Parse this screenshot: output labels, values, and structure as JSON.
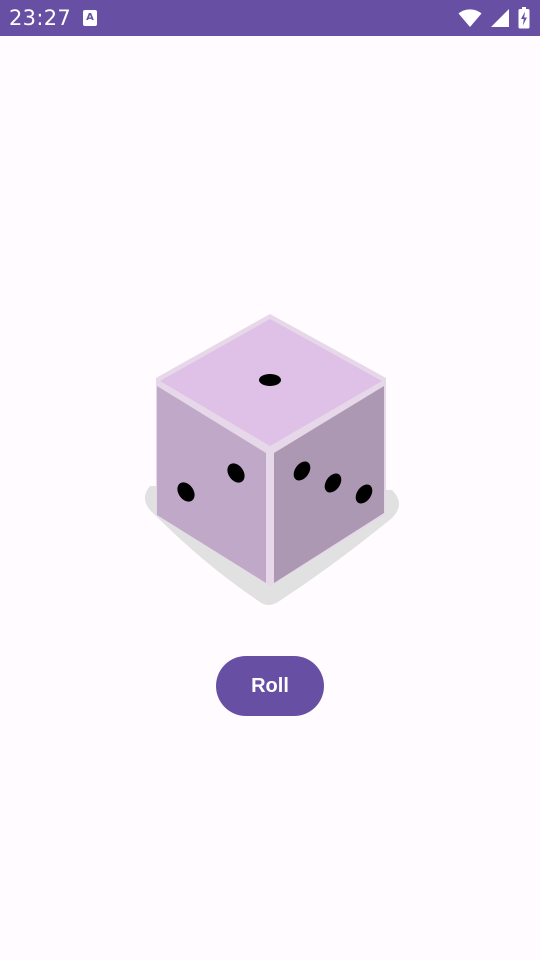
{
  "status_bar": {
    "time": "23:27",
    "notification_icon": "A",
    "icons": [
      "wifi-icon",
      "cellular-signal-icon",
      "battery-charging-icon"
    ],
    "background": "#6750a4"
  },
  "dice": {
    "image": "dice-icon",
    "top_face_pips": 1,
    "left_face_pips": 2,
    "right_face_pips": 3
  },
  "roll_button": {
    "label": "Roll",
    "background": "#6750a4",
    "text_color": "#ffffff"
  },
  "colors": {
    "accent": "#6750a4",
    "background": "#fffbfe",
    "dice_top": "#dfc0e6",
    "dice_left": "#c0a8c8",
    "dice_right": "#ad98b3"
  }
}
